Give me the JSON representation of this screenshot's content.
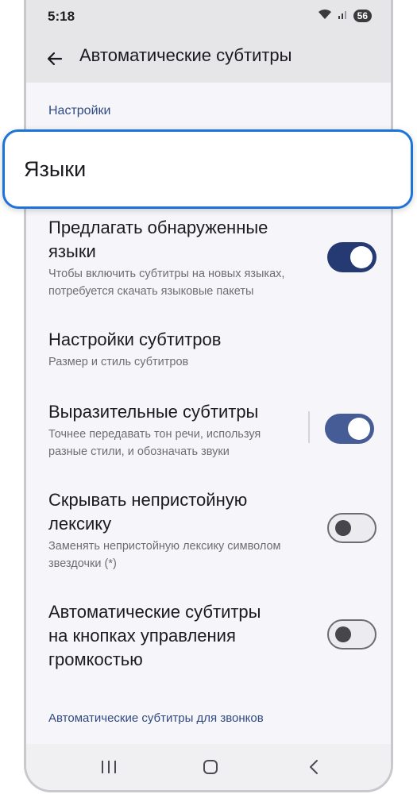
{
  "status_bar": {
    "time": "5:18",
    "battery": "56",
    "icons": [
      "wifi-icon",
      "signal-icon",
      "battery-icon"
    ]
  },
  "app_bar": {
    "title": "Автоматические субтитры",
    "back_icon": "arrow-left-icon"
  },
  "sections": {
    "settings_header": "Настройки",
    "calls_header": "Автоматические субтитры для звонков"
  },
  "highlighted_item": {
    "label": "Языки"
  },
  "settings": [
    {
      "title_line1": "Предлагать обнаруженные",
      "title_line2": "языки",
      "subtitle_line1": "Чтобы включить субтитры на новых языках,",
      "subtitle_line2": "потребуется скачать языковые пакеты",
      "toggle_state": "on"
    },
    {
      "title_line1": "Настройки субтитров",
      "subtitle_line1": "Размер и стиль субтитров"
    },
    {
      "title_line1": "Выразительные субтитры",
      "subtitle_line1": "Точнее передавать тон речи, используя",
      "subtitle_line2": "разные стили, и обозначать звуки",
      "toggle_state": "on"
    },
    {
      "title_line1": "Скрывать непристойную",
      "title_line2": "лексику",
      "subtitle_line1": "Заменять непристойную лексику символом",
      "subtitle_line2": "звездочки (*)",
      "toggle_state": "off"
    },
    {
      "title_line1": "Автоматические субтитры",
      "title_line2": "на кнопках управления",
      "title_line3": "громкостью",
      "toggle_state": "off"
    }
  ],
  "nav_bar": {
    "icons": [
      "recents-icon",
      "home-icon",
      "back-icon"
    ]
  },
  "colors": {
    "accent_dark": "#253a73",
    "accent_light": "#455c96",
    "highlight_border": "#1e73d8",
    "section_header": "#2f4a82"
  }
}
